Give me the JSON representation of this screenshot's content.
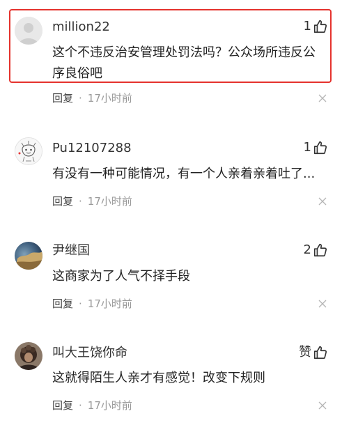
{
  "comments": [
    {
      "username": "million22",
      "likes": "1",
      "content": "这个不违反治安管理处罚法吗？公众场所违反公序良俗吧",
      "reply_label": "回复",
      "separator": "·",
      "time": "17小时前",
      "highlighted": true
    },
    {
      "username": "Pu12107288",
      "likes": "1",
      "content": "有没有一种可能情况，有一个人亲着亲着吐了...",
      "reply_label": "回复",
      "separator": "·",
      "time": "17小时前"
    },
    {
      "username": "尹继国",
      "likes": "2",
      "content": "这商家为了人气不择手段",
      "reply_label": "回复",
      "separator": "·",
      "time": "17小时前"
    },
    {
      "username": "叫大王饶你命",
      "likes": "赞",
      "content": "这就得陌生人亲才有感觉！改变下规则",
      "reply_label": "回复",
      "separator": "·",
      "time": "17小时前"
    }
  ],
  "icons": {
    "like": "thumbs-up-icon",
    "close": "close-icon"
  },
  "colors": {
    "highlight_border": "#e5322d",
    "time_text": "#999999"
  }
}
